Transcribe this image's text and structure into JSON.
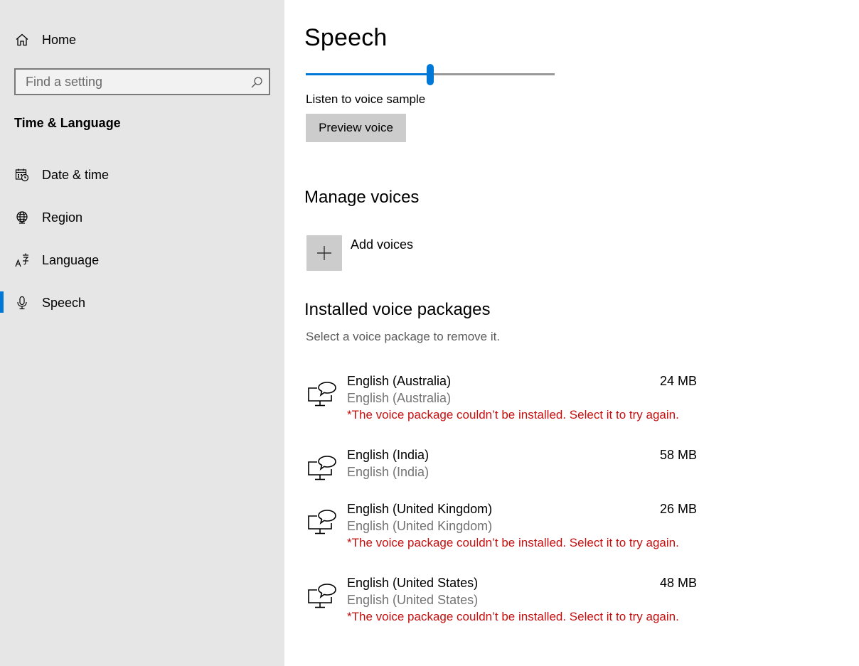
{
  "sidebar": {
    "home_label": "Home",
    "search": {
      "placeholder": "Find a setting"
    },
    "section_title": "Time & Language",
    "items": [
      {
        "label": "Date & time",
        "icon": "calendar-clock-icon"
      },
      {
        "label": "Region",
        "icon": "globe-icon"
      },
      {
        "label": "Language",
        "icon": "language-icon"
      },
      {
        "label": "Speech",
        "icon": "microphone-icon",
        "active": true
      }
    ]
  },
  "main": {
    "title": "Speech",
    "speed_slider": {
      "value_fraction": 0.5
    },
    "listen_label": "Listen to voice sample",
    "preview_button": "Preview voice",
    "manage_voices": {
      "heading": "Manage voices",
      "add_label": "Add voices"
    },
    "installed": {
      "heading": "Installed voice packages",
      "hint": "Select a voice package to remove it.",
      "packages": [
        {
          "name": "English (Australia)",
          "sub": "English (Australia)",
          "size": "24 MB",
          "error": "*The voice package couldn’t be installed. Select it to try again."
        },
        {
          "name": "English (India)",
          "sub": "English (India)",
          "size": "58 MB",
          "error": ""
        },
        {
          "name": "English (United Kingdom)",
          "sub": "English (United Kingdom)",
          "size": "26 MB",
          "error": "*The voice package couldn’t be installed. Select it to try again."
        },
        {
          "name": "English (United States)",
          "sub": "English (United States)",
          "size": "48 MB",
          "error": "*The voice package couldn’t be installed. Select it to try again."
        }
      ]
    }
  },
  "colors": {
    "accent": "#0078d7",
    "error": "#c50f0f",
    "sidebar_bg": "#e6e6e6",
    "button_bg": "#cccccc"
  }
}
